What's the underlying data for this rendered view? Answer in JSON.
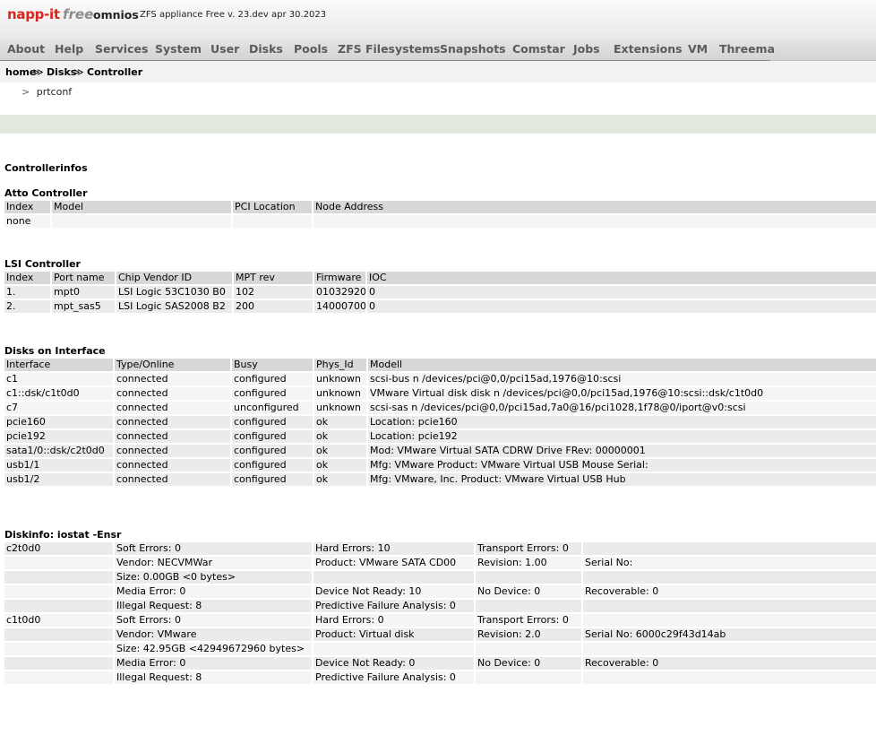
{
  "header": {
    "logo_text": "napp-it",
    "logo_free": "free",
    "product": "omnios",
    "version_text": "ZFS appliance Free v. 23.dev apr 30.2023"
  },
  "menu": [
    "About",
    "Help",
    "Services",
    "System",
    "User",
    "Disks",
    "Pools",
    "ZFS Filesystems",
    "Snapshots",
    "Comstar",
    "Jobs",
    "Extensions",
    "VM",
    "Threema"
  ],
  "breadcrumb": [
    "home",
    "Disks",
    "Controller"
  ],
  "breadcrumb_sep": "≫",
  "subnav": {
    "arrow": ">",
    "label": "prtconf"
  },
  "page_title": "Controllerinfos",
  "atto": {
    "title": "Atto Controller",
    "headers": [
      "Index",
      "Model",
      "PCI Location",
      "Node Address"
    ],
    "rows": [
      [
        "none",
        "",
        "",
        ""
      ]
    ]
  },
  "lsi": {
    "title": "LSI Controller",
    "headers": [
      "Index",
      "Port name",
      "Chip Vendor ID",
      "MPT rev",
      "Firmware",
      "IOC"
    ],
    "rows": [
      [
        "1.",
        "mpt0",
        "LSI Logic 53C1030 B0",
        "102",
        "01032920",
        "0"
      ],
      [
        "2.",
        "mpt_sas5",
        "LSI Logic SAS2008 B2",
        "200",
        "14000700",
        "0"
      ]
    ]
  },
  "disks": {
    "title": "Disks on Interface",
    "headers": [
      "Interface",
      "Type/Online",
      "Busy",
      "Phys_Id",
      "Modell"
    ],
    "rows": [
      [
        "c1",
        "connected",
        "configured",
        "unknown",
        "scsi-bus n /devices/pci@0,0/pci15ad,1976@10:scsi"
      ],
      [
        "c1::dsk/c1t0d0",
        "connected",
        "configured",
        "unknown",
        "VMware Virtual disk disk n /devices/pci@0,0/pci15ad,1976@10:scsi::dsk/c1t0d0"
      ],
      [
        "c7",
        "connected",
        "unconfigured",
        "unknown",
        "scsi-sas n /devices/pci@0,0/pci15ad,7a0@16/pci1028,1f78@0/iport@v0:scsi"
      ],
      [
        "pcie160",
        "connected",
        "configured",
        "ok",
        "Location: pcie160"
      ],
      [
        "pcie192",
        "connected",
        "configured",
        "ok",
        "Location: pcie192"
      ],
      [
        "sata1/0::dsk/c2t0d0",
        "connected",
        "configured",
        "ok",
        "Mod: VMware Virtual SATA CDRW Drive FRev: 00000001"
      ],
      [
        "usb1/1",
        "connected",
        "configured",
        "ok",
        "Mfg: VMware Product: VMware Virtual USB Mouse Serial:"
      ],
      [
        "usb1/2",
        "connected",
        "configured",
        "ok",
        "Mfg: VMware, Inc. Product: VMware Virtual USB Hub"
      ]
    ]
  },
  "diskinfo": {
    "title": "Diskinfo: iostat -Ensr",
    "rows": [
      [
        "c2t0d0",
        "Soft Errors: 0",
        "Hard Errors: 10",
        "Transport Errors: 0",
        ""
      ],
      [
        "",
        "Vendor: NECVMWar",
        "Product: VMware SATA CD00",
        "Revision: 1.00",
        "Serial No:"
      ],
      [
        "",
        "Size: 0.00GB <0 bytes>",
        "",
        "",
        ""
      ],
      [
        "",
        "Media Error: 0",
        "Device Not Ready: 10",
        "No Device: 0",
        "Recoverable: 0"
      ],
      [
        "",
        "Illegal Request: 8",
        "Predictive Failure Analysis: 0",
        "",
        ""
      ],
      [
        "c1t0d0",
        "Soft Errors: 0",
        "Hard Errors: 0",
        "Transport Errors: 0",
        ""
      ],
      [
        "",
        "Vendor: VMware",
        "Product: Virtual disk",
        "Revision: 2.0",
        "Serial No: 6000c29f43d14ab"
      ],
      [
        "",
        "Size: 42.95GB <42949672960 bytes>",
        "",
        "",
        ""
      ],
      [
        "",
        "Media Error: 0",
        "Device Not Ready: 0",
        "No Device: 0",
        "Recoverable: 0"
      ],
      [
        "",
        "Illegal Request: 8",
        "Predictive Failure Analysis: 0",
        "",
        ""
      ]
    ]
  }
}
